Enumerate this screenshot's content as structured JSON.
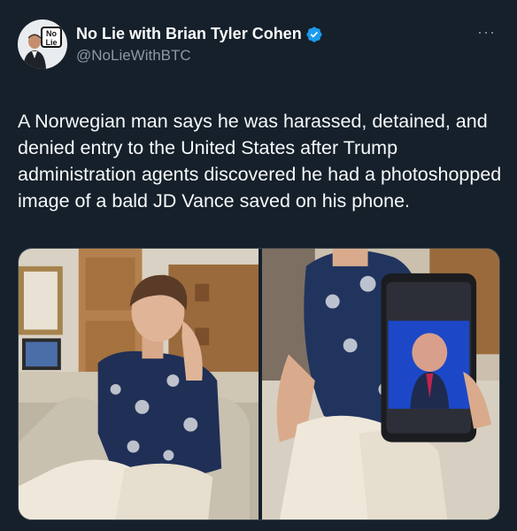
{
  "tweet": {
    "display_name": "No Lie with Brian Tyler Cohen",
    "handle": "@NoLieWithBTC",
    "more_label": "···",
    "avatar_logo_text": "No Lie",
    "body": "A Norwegian man says he was harassed, detained, and denied entry to the United States after Trump administration agents discovered he had a photoshopped image of a bald JD Vance saved on his phone."
  },
  "icons": {
    "verified": "verified-badge-icon",
    "more": "more-options-icon"
  },
  "colors": {
    "background": "#15202b",
    "text_primary": "#f7f9f9",
    "text_secondary": "#8b98a5",
    "verified_blue": "#1d9bf0",
    "border": "#38444d"
  }
}
